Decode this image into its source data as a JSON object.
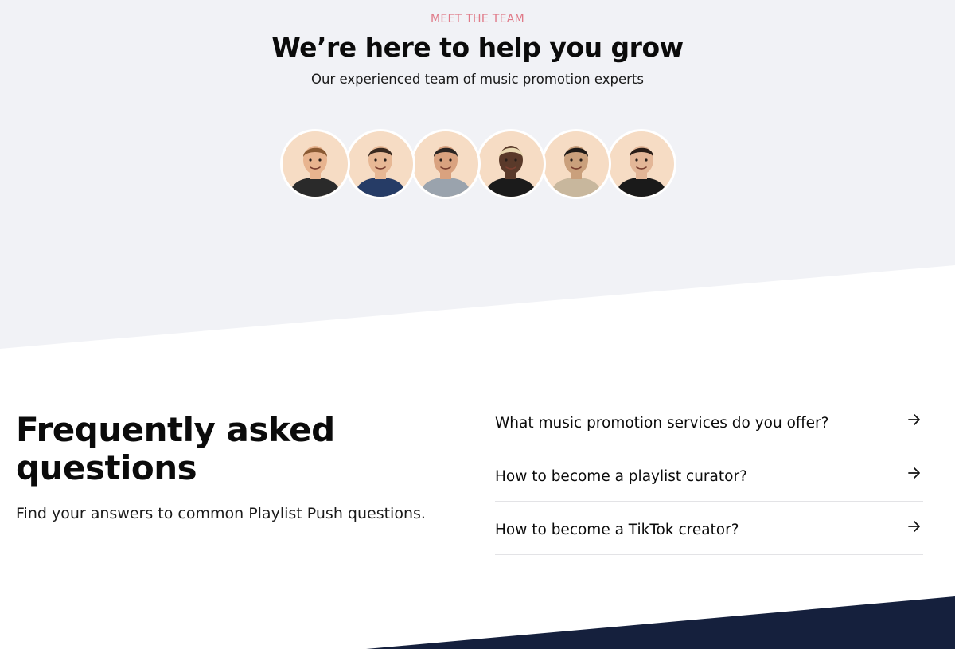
{
  "team": {
    "eyebrow": "MEET THE TEAM",
    "headline": "We’re here to help you grow",
    "subhead": "Our experienced team of music promotion experts",
    "members": [
      {
        "icon": "team-member-1-avatar",
        "skin": "#e8b48f",
        "hair": "#8a5a33",
        "shirt": "#2a2a2a"
      },
      {
        "icon": "team-member-2-avatar",
        "skin": "#e7b895",
        "hair": "#3a2a20",
        "shirt": "#263c66"
      },
      {
        "icon": "team-member-3-avatar",
        "skin": "#d9a27f",
        "hair": "#2b2522",
        "shirt": "#9aa3ad"
      },
      {
        "icon": "team-member-4-avatar",
        "skin": "#5a3a2a",
        "hair": "#e8d7b0",
        "shirt": "#1b1b1b"
      },
      {
        "icon": "team-member-5-avatar",
        "skin": "#caa07c",
        "hair": "#1f1a17",
        "shirt": "#c8b79d"
      },
      {
        "icon": "team-member-6-avatar",
        "skin": "#e3b697",
        "hair": "#2a1d17",
        "shirt": "#1a1a1a"
      }
    ]
  },
  "faq": {
    "title": "Frequently asked questions",
    "subtitle": "Find your answers to common Playlist Push questions.",
    "items": [
      {
        "question": "What music promotion services do you offer?",
        "icon": "arrow-right-icon"
      },
      {
        "question": "How to become a playlist curator?",
        "icon": "arrow-right-icon"
      },
      {
        "question": "How to become a TikTok creator?",
        "icon": "arrow-right-icon"
      }
    ]
  },
  "colors": {
    "accent": "#e07a88",
    "section_gray": "#f1f2f6",
    "footer_navy": "#15203d",
    "avatar_bg": "#f6dcc4"
  }
}
